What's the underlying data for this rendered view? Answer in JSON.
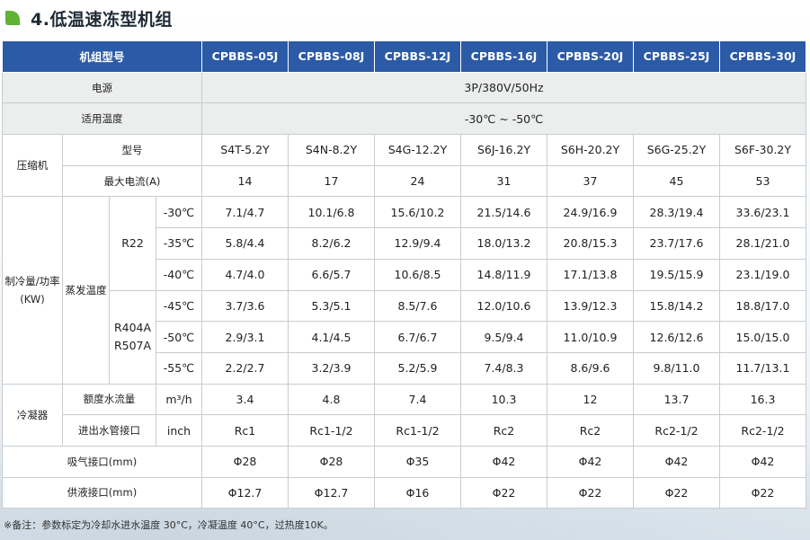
{
  "title": "4.低温速冻型机组",
  "header": {
    "label": "机组型号",
    "models": [
      "CPBBS-05J",
      "CPBBS-08J",
      "CPBBS-12J",
      "CPBBS-16J",
      "CPBBS-20J",
      "CPBBS-25J",
      "CPBBS-30J"
    ]
  },
  "power": {
    "label": "电源",
    "value": "3P/380V/50Hz"
  },
  "temp_range": {
    "label": "适用温度",
    "value": "-30℃ ~ -50℃"
  },
  "compressor": {
    "label": "压缩机",
    "model": {
      "label": "型号",
      "values": [
        "S4T-5.2Y",
        "S4N-8.2Y",
        "S4G-12.2Y",
        "S6J-16.2Y",
        "S6H-20.2Y",
        "S6G-25.2Y",
        "S6F-30.2Y"
      ]
    },
    "max_current": {
      "label": "最大电流(A)",
      "values": [
        "14",
        "17",
        "24",
        "31",
        "37",
        "45",
        "53"
      ]
    }
  },
  "capacity": {
    "label": "制冷量/功率(KW)",
    "evap_label": "蒸发温度",
    "refrigerants": [
      {
        "name": "R22",
        "rows": [
          {
            "temp": "-30℃",
            "values": [
              "7.1/4.7",
              "10.1/6.8",
              "15.6/10.2",
              "21.5/14.6",
              "24.9/16.9",
              "28.3/19.4",
              "33.6/23.1"
            ]
          },
          {
            "temp": "-35℃",
            "values": [
              "5.8/4.4",
              "8.2/6.2",
              "12.9/9.4",
              "18.0/13.2",
              "20.8/15.3",
              "23.7/17.6",
              "28.1/21.0"
            ]
          },
          {
            "temp": "-40℃",
            "values": [
              "4.7/4.0",
              "6.6/5.7",
              "10.6/8.5",
              "14.8/11.9",
              "17.1/13.8",
              "19.5/15.9",
              "23.1/19.0"
            ]
          }
        ]
      },
      {
        "name": "R404A R507A",
        "rows": [
          {
            "temp": "-45℃",
            "values": [
              "3.7/3.6",
              "5.3/5.1",
              "8.5/7.6",
              "12.0/10.6",
              "13.9/12.3",
              "15.8/14.2",
              "18.8/17.0"
            ]
          },
          {
            "temp": "-50℃",
            "values": [
              "2.9/3.1",
              "4.1/4.5",
              "6.7/6.7",
              "9.5/9.4",
              "11.0/10.9",
              "12.6/12.6",
              "15.0/15.0"
            ]
          },
          {
            "temp": "-55℃",
            "values": [
              "2.2/2.7",
              "3.2/3.9",
              "5.2/5.9",
              "7.4/8.3",
              "8.6/9.6",
              "9.8/11.0",
              "11.7/13.1"
            ]
          }
        ]
      }
    ]
  },
  "condenser": {
    "label": "冷凝器",
    "flow": {
      "label": "额度水流量",
      "unit": "m³/h",
      "values": [
        "3.4",
        "4.8",
        "7.4",
        "10.3",
        "12",
        "13.7",
        "16.3"
      ]
    },
    "pipe": {
      "label": "进出水管接口",
      "unit": "inch",
      "values": [
        "Rc1",
        "Rc1-1/2",
        "Rc1-1/2",
        "Rc2",
        "Rc2",
        "Rc2-1/2",
        "Rc2-1/2"
      ]
    }
  },
  "suction": {
    "label": "吸气接口(mm)",
    "values": [
      "Φ28",
      "Φ28",
      "Φ35",
      "Φ42",
      "Φ42",
      "Φ42",
      "Φ42"
    ]
  },
  "liquid": {
    "label": "供液接口(mm)",
    "values": [
      "Φ12.7",
      "Φ12.7",
      "Φ16",
      "Φ22",
      "Φ22",
      "Φ22",
      "Φ22"
    ]
  },
  "footnote": "※备注：参数标定为冷却水进水温度 30°C，冷凝温度 40°C，过热度10K。",
  "colors": {
    "header_bg": "#2b5aa7",
    "accent_leaf": "#5fb233",
    "gray_cell": "#eceded"
  }
}
